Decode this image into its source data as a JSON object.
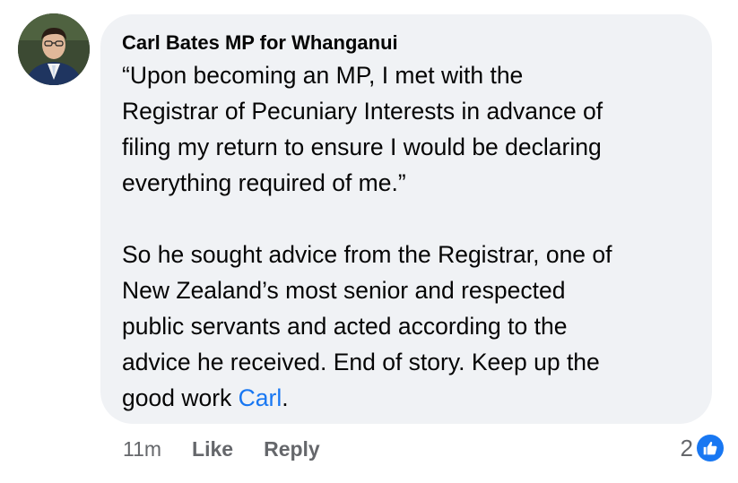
{
  "comment": {
    "author": "Carl Bates MP for Whanganui",
    "paragraph1": [
      "“Upon becoming an MP, I met with the",
      "Registrar of Pecuniary Interests in advance of",
      "filing my return to ensure I would be declaring",
      "everything required of me.”"
    ],
    "paragraph2": [
      "So he sought advice from the Registrar, one of",
      "New Zealand’s most senior and respected",
      "public servants and acted according to the",
      "advice he received. End of story. Keep up the"
    ],
    "last_line_prefix": "good work ",
    "mention": "Carl",
    "last_line_suffix": "."
  },
  "actions": {
    "time": "11m",
    "like_label": "Like",
    "reply_label": "Reply"
  },
  "reactions": {
    "count": "2",
    "icon": "thumbs-up-icon"
  },
  "colors": {
    "bubble": "#f0f2f5",
    "text": "#050505",
    "secondary": "#65676b",
    "accent": "#1877f2"
  }
}
